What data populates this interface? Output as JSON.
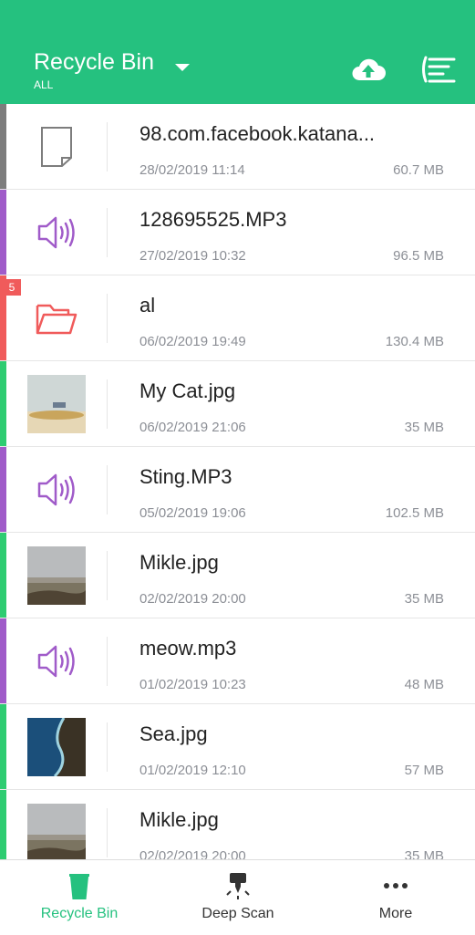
{
  "header": {
    "title": "Recycle Bin",
    "subtitle": "ALL",
    "icons": [
      "chevron-down-icon",
      "cloud-upload-icon",
      "sort-icon"
    ]
  },
  "items": [
    {
      "name": "98.com.facebook.katana...",
      "date": "28/02/2019  11:14",
      "size": "60.7 MB",
      "type": "file",
      "color": "#7d7d7d"
    },
    {
      "name": "128695525.MP3",
      "date": "27/02/2019  10:32",
      "size": "96.5 MB",
      "type": "audio",
      "color": "#a05bc9"
    },
    {
      "name": "al",
      "date": "06/02/2019  19:49",
      "size": "130.4 MB",
      "type": "folder",
      "color": "#f05b5b",
      "badge": "5"
    },
    {
      "name": "My Cat.jpg",
      "date": "06/02/2019  21:06",
      "size": "35 MB",
      "type": "image",
      "color": "#2ecc71",
      "thumb": "beach"
    },
    {
      "name": "Sting.MP3",
      "date": "05/02/2019  19:06",
      "size": "102.5 MB",
      "type": "audio",
      "color": "#a05bc9"
    },
    {
      "name": "Mikle.jpg",
      "date": "02/02/2019  20:00",
      "size": "35 MB",
      "type": "image",
      "color": "#2ecc71",
      "thumb": "field"
    },
    {
      "name": "meow.mp3",
      "date": "01/02/2019  10:23",
      "size": "48 MB",
      "type": "audio",
      "color": "#a05bc9"
    },
    {
      "name": "Sea.jpg",
      "date": "01/02/2019  12:10",
      "size": "57 MB",
      "type": "image",
      "color": "#2ecc71",
      "thumb": "sea"
    },
    {
      "name": "Mikle.jpg",
      "date": "02/02/2019  20:00",
      "size": "35 MB",
      "type": "image",
      "color": "#2ecc71",
      "thumb": "field"
    }
  ],
  "bottom_nav": [
    {
      "label": "Recycle Bin",
      "icon": "trash-bin-icon",
      "active": true
    },
    {
      "label": "Deep Scan",
      "icon": "drill-icon",
      "active": false
    },
    {
      "label": "More",
      "icon": "more-dots-icon",
      "active": false
    }
  ],
  "colors": {
    "accent": "#25c17f",
    "audio": "#a05bc9",
    "folder": "#f05b5b",
    "image": "#2ecc71",
    "file": "#7d7d7d"
  }
}
